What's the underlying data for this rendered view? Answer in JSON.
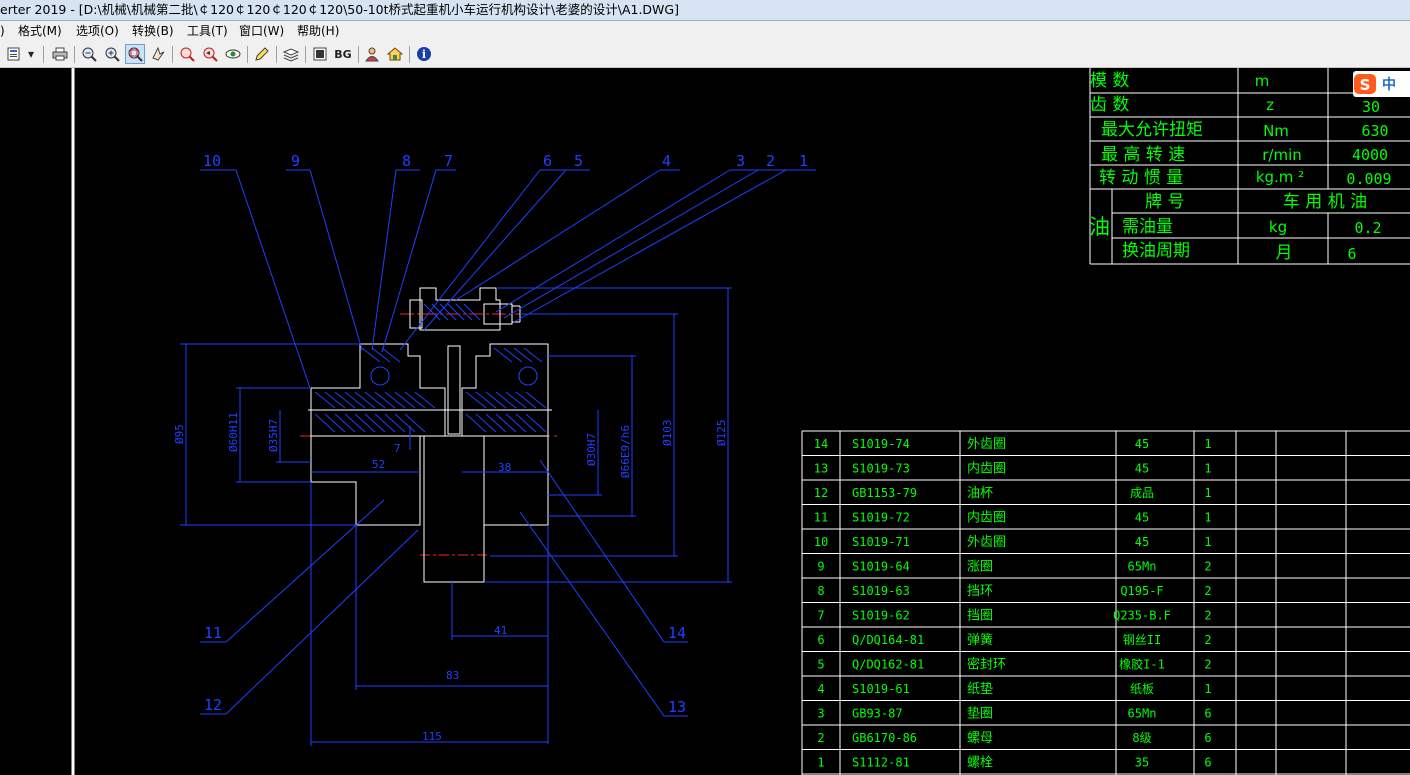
{
  "window": {
    "title": "erter 2019 - [D:\\机械\\机械第二批\\￠120￠120￠120￠120\\50-10t桥式起重机小车运行机构设计\\老婆的设计\\A1.DWG]"
  },
  "menu": {
    "items": [
      {
        "label": ")"
      },
      {
        "label": "格式(M)"
      },
      {
        "label": "选项(O)"
      },
      {
        "label": "转换(B)"
      },
      {
        "label": "工具(T)"
      },
      {
        "label": "窗口(W)"
      },
      {
        "label": "帮助(H)"
      }
    ]
  },
  "toolbar": {
    "bg_label": "BG",
    "info_label": "i",
    "dropdown_label": "▾"
  },
  "ime": {
    "label": "中"
  },
  "drawing": {
    "part_labels": [
      "10",
      "9",
      "8",
      "7",
      "6",
      "5",
      "4",
      "3",
      "2",
      "1",
      "11",
      "12",
      "13",
      "14"
    ],
    "dimensions": {
      "d95": "Ø95",
      "d60h11": "Ø60H11",
      "d35h7": "Ø35H7",
      "d30h7": "Ø30H7",
      "d66e9h6": "Ø66E9/h6",
      "d103": "Ø103",
      "d125": "Ø125",
      "d52": "52",
      "d38": "38",
      "d41": "41",
      "d83": "83",
      "d115": "115",
      "d7": "7"
    }
  },
  "param_table": {
    "rows": [
      {
        "name": "模      数",
        "unit": "m",
        "value": ""
      },
      {
        "name": "齿      数",
        "unit": "z",
        "value": "30"
      },
      {
        "name": "最大允许扭矩",
        "unit": "Nm",
        "value": "630"
      },
      {
        "name": "最 高 转 速",
        "unit": "r/min",
        "value": "4000"
      },
      {
        "name": "转 动 惯 量",
        "unit": "kg.m  ²",
        "value": "0.009"
      },
      {
        "name": "牌   号",
        "unit": "车 用 机 油",
        "value": ""
      },
      {
        "name": "需油量",
        "unit": "kg",
        "value": "0.2"
      },
      {
        "name": "换油周期",
        "unit": "月",
        "value": "6"
      }
    ],
    "side_label": "油"
  },
  "parts_list": {
    "rows": [
      {
        "no": "14",
        "code": "S1019-74",
        "name": "外齿圈",
        "material": "45",
        "qty": "1"
      },
      {
        "no": "13",
        "code": "S1019-73",
        "name": "内齿圈",
        "material": "45",
        "qty": "1"
      },
      {
        "no": "12",
        "code": "GB1153-79",
        "name": "油杯",
        "material": "成品",
        "qty": "1"
      },
      {
        "no": "11",
        "code": "S1019-72",
        "name": "内齿圈",
        "material": "45",
        "qty": "1"
      },
      {
        "no": "10",
        "code": "S1019-71",
        "name": "外齿圈",
        "material": "45",
        "qty": "1"
      },
      {
        "no": "9",
        "code": "S1019-64",
        "name": "涨圈",
        "material": "65Mn",
        "qty": "2"
      },
      {
        "no": "8",
        "code": "S1019-63",
        "name": "挡环",
        "material": "Q195-F",
        "qty": "2"
      },
      {
        "no": "7",
        "code": "S1019-62",
        "name": "挡圈",
        "material": "Q235-B.F",
        "qty": "2"
      },
      {
        "no": "6",
        "code": "Q/DQ164-81",
        "name": "弹簧",
        "material": "钢丝II",
        "qty": "2"
      },
      {
        "no": "5",
        "code": "Q/DQ162-81",
        "name": "密封环",
        "material": "橡胶I-1",
        "qty": "2"
      },
      {
        "no": "4",
        "code": "S1019-61",
        "name": "纸垫",
        "material": "纸板",
        "qty": "1"
      },
      {
        "no": "3",
        "code": "GB93-87",
        "name": "垫圈",
        "material": "65Mn",
        "qty": "6"
      },
      {
        "no": "2",
        "code": "GB6170-86",
        "name": "螺母",
        "material": "8级",
        "qty": "6"
      },
      {
        "no": "1",
        "code": "S1112-81",
        "name": "螺栓",
        "material": "35",
        "qty": "6"
      }
    ]
  },
  "colors": {
    "blue": "#0000ff",
    "white": "#ffffff",
    "red": "#ff2020",
    "green": "#00ff00"
  }
}
